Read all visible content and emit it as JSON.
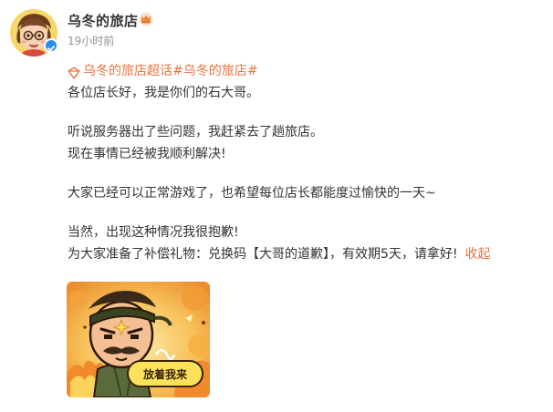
{
  "header": {
    "username": "乌冬的旅店",
    "time": "19小时前"
  },
  "post": {
    "topic": "乌冬的旅店超话#乌冬的旅店#",
    "lines": [
      "各位店长好，我是你们的石大哥。",
      "听说服务器出了些问题，我赶紧去了趟旅店。",
      "现在事情已经被我顺利解决!",
      "大家已经可以正常游戏了，也希望每位店长都能度过愉快的一天~",
      "当然，出现这种情况我很抱歉!",
      "为大家准备了补偿礼物：兑换码【大哥的道歉】，有效期5天，请拿好!"
    ],
    "collapse_label": "收起"
  },
  "image": {
    "button_label": "放着我来"
  },
  "colors": {
    "accent": "#eb7340",
    "text": "#333333",
    "muted": "#939393",
    "verified": "#2a8cf0"
  }
}
